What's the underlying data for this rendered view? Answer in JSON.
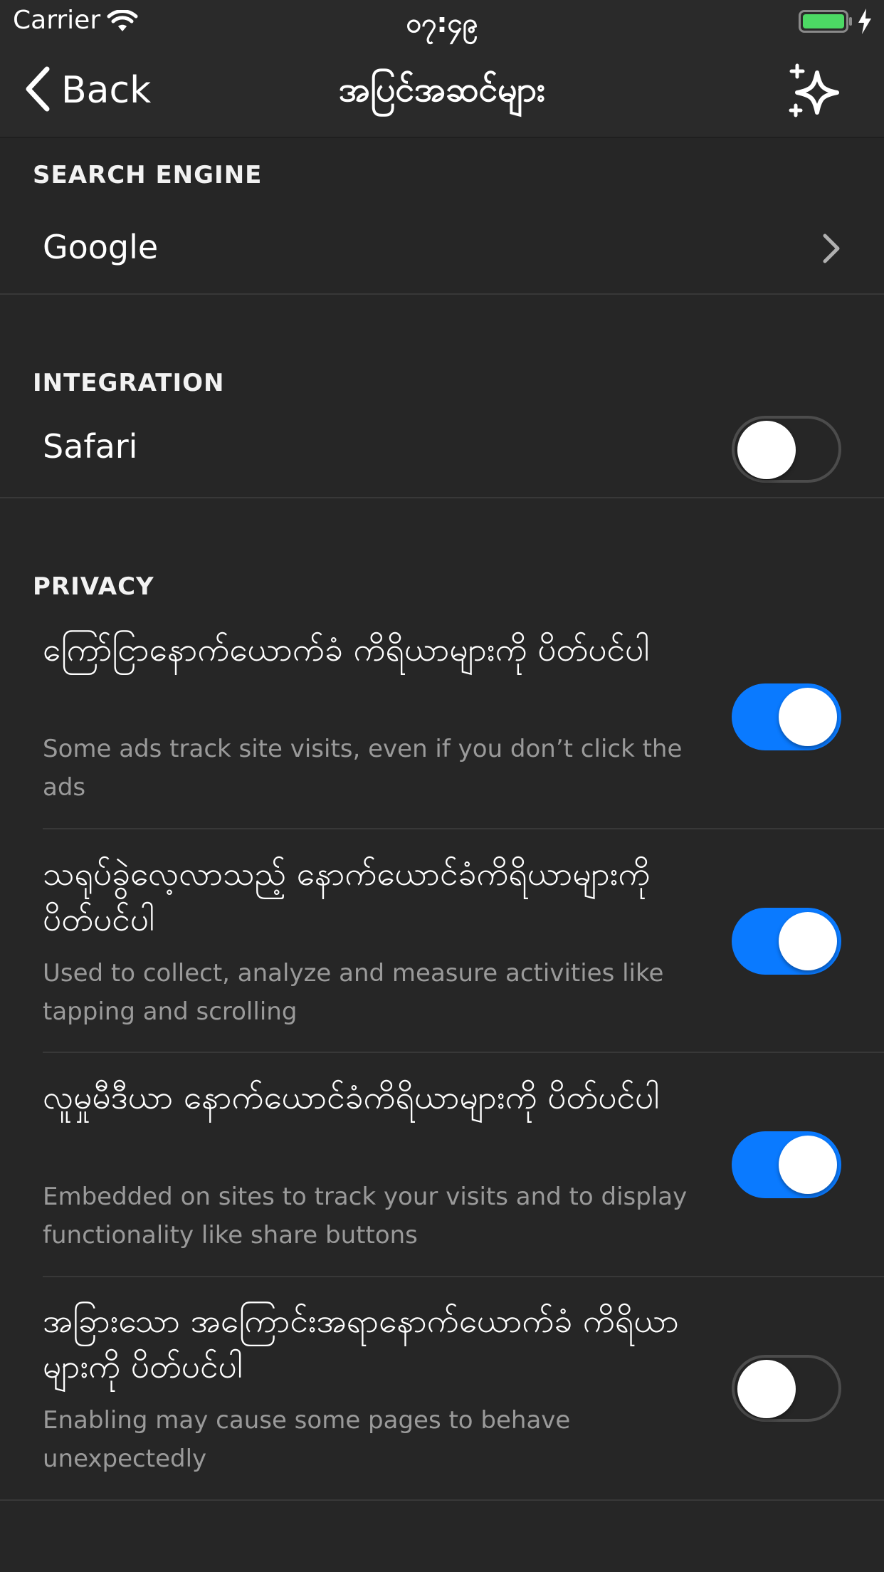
{
  "status_bar": {
    "carrier": "Carrier",
    "time": "၀၇:၄၉",
    "battery_color": "#4cd964"
  },
  "nav": {
    "back_label": "Back",
    "title": "အပြင်အဆင်များ",
    "right_icon": "sparkle-icon"
  },
  "search_engine": {
    "header": "SEARCH ENGINE",
    "value": "Google"
  },
  "integration": {
    "header": "INTEGRATION",
    "safari_label": "Safari",
    "safari_enabled": false
  },
  "privacy": {
    "header": "PRIVACY",
    "items": [
      {
        "title": "ကြော်ငြာနောက်ယောက်ခံ ကိရိယာများကို ပိတ်ပင်ပါ",
        "description": "Some ads track site visits, even if you don’t click the ads",
        "enabled": true
      },
      {
        "title": "သရုပ်ခွဲလေ့လာသည့် နောက်ယောင်ခံကိရိယာများကို ပိတ်ပင်ပါ",
        "description": "Used to collect, analyze and measure activities like tapping and scrolling",
        "enabled": true
      },
      {
        "title": "လူမှုမီဒီယာ နောက်ယောင်ခံကိရိယာများကို ပိတ်ပင်ပါ",
        "description": "Embedded on sites to track your visits and to display functionality like share buttons",
        "enabled": true
      },
      {
        "title": "အခြားသော အကြောင်းအရာနောက်ယောက်ခံ ကိရိယာများကို ပိတ်ပင်ပါ",
        "description": "Enabling may cause some pages to behave unexpectedly",
        "enabled": false
      }
    ]
  },
  "colors": {
    "accent": "#0a7aff",
    "background": "#262626"
  }
}
